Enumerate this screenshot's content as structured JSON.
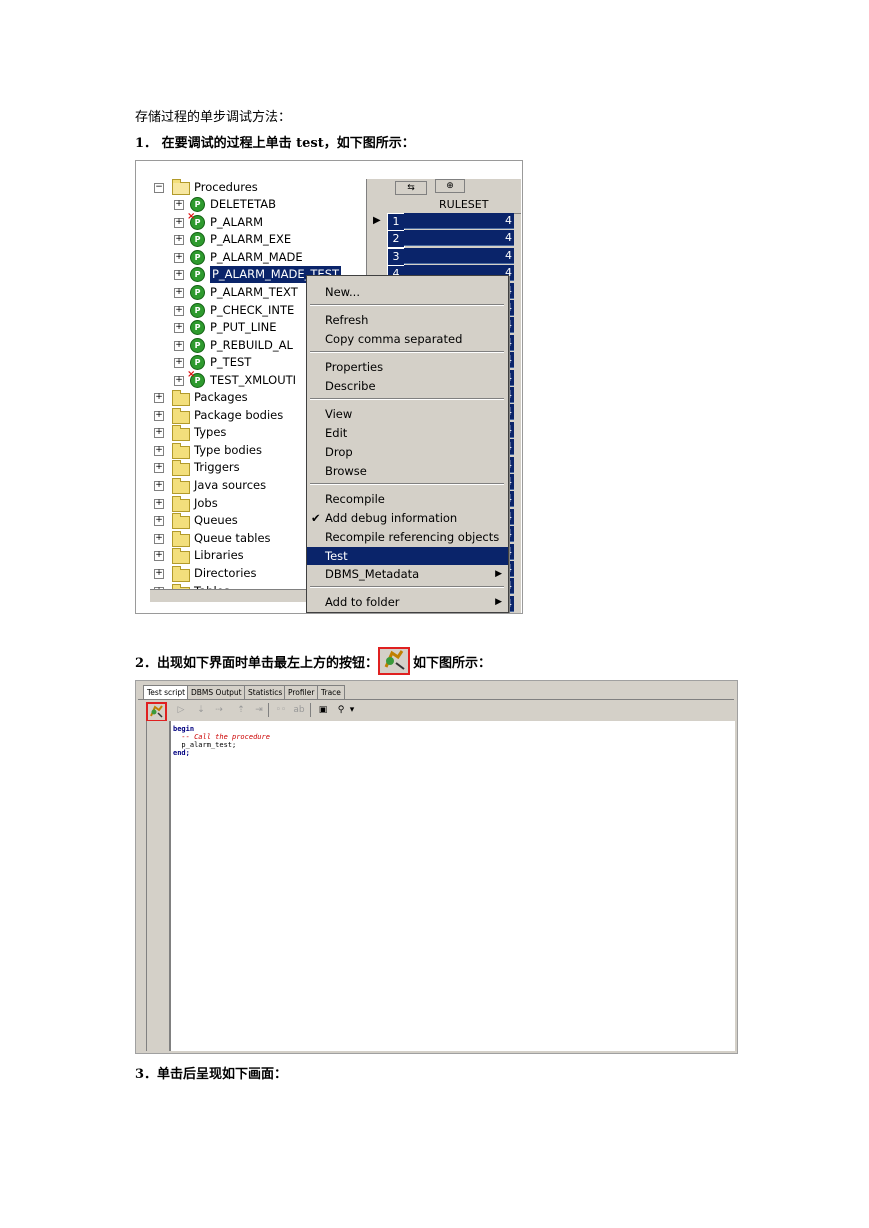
{
  "doc": {
    "heading": "存储过程的单步调试方法：",
    "step1": "1．  在要调试的过程上单击 test，如下图所示：",
    "step2_before": "2．出现如下界面时单击最左上方的按钮：",
    "step2_after": "，如下图所示：",
    "step3": "3．单击后呈现如下画面："
  },
  "tree": {
    "procedures_label": "Procedures",
    "procedures": [
      "DELETETAB",
      "P_ALARM",
      "P_ALARM_EXE",
      "P_ALARM_MADE",
      "P_ALARM_MADE_TEST",
      "P_ALARM_TEXT",
      "P_CHECK_INTE",
      "P_PUT_LINE",
      "P_REBUILD_AL",
      "P_TEST",
      "TEST_XMLOUTI"
    ],
    "folders": [
      "Packages",
      "Package bodies",
      "Types",
      "Type bodies",
      "Triggers",
      "Java sources",
      "Jobs",
      "Queues",
      "Queue tables",
      "Libraries",
      "Directories",
      "Tables"
    ]
  },
  "grid": {
    "column_header": "RULESET",
    "row_numbers": [
      "1",
      "2",
      "3",
      "4"
    ],
    "cell_value": "4"
  },
  "context_menu": {
    "items": [
      "New...",
      "Refresh",
      "Copy comma separated",
      "Properties",
      "Describe",
      "View",
      "Edit",
      "Drop",
      "Browse",
      "Recompile",
      "Add debug information",
      "Recompile referencing objects",
      "Test",
      "DBMS_Metadata",
      "Add to folder"
    ],
    "checked_item": "Add debug information",
    "highlighted_item": "Test"
  },
  "test_window": {
    "tabs": [
      "Test script",
      "DBMS Output",
      "Statistics",
      "Profiler",
      "Trace"
    ],
    "code": [
      "begin",
      "  -- Call the procedure",
      "  p_alarm_test;",
      "end;"
    ]
  },
  "colors": {
    "highlight": "#0a246a",
    "red_box": "#e02020",
    "comment": "#cc0000",
    "proc_icon": "#2e9a2e"
  }
}
